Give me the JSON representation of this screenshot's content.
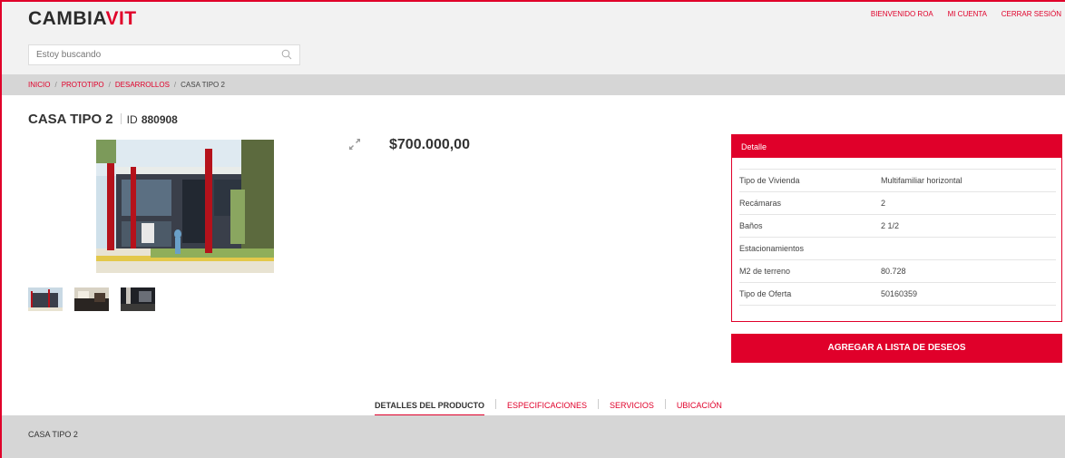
{
  "header": {
    "logo_main": "CAMBIA",
    "logo_accent": "VIT",
    "links": [
      "BIENVENIDO ROA",
      "MI CUENTA",
      "CERRAR SESIÓN"
    ]
  },
  "search": {
    "placeholder": "Estoy buscando"
  },
  "breadcrumb": {
    "items": [
      "INICIO",
      "PROTOTIPO",
      "DESARROLLOS"
    ],
    "current": "CASA TIPO 2",
    "separator": "/"
  },
  "product": {
    "title": "CASA TIPO 2",
    "id_label": "ID",
    "id_value": "880908",
    "price": "$700.000,00"
  },
  "detail": {
    "heading": "Detalle",
    "rows": [
      {
        "label": "Tipo de Vivienda",
        "value": "Multifamiliar horizontal"
      },
      {
        "label": "Recámaras",
        "value": "2"
      },
      {
        "label": "Baños",
        "value": "2 1/2"
      },
      {
        "label": "Estacionamientos",
        "value": ""
      },
      {
        "label": "M2 de terreno",
        "value": "80.728"
      },
      {
        "label": "Tipo de Oferta",
        "value": "50160359"
      }
    ]
  },
  "wishlist_button": "AGREGAR A LISTA DE DESEOS",
  "tabs": [
    {
      "label": "DETALLES DEL PRODUCTO",
      "active": true
    },
    {
      "label": "ESPECIFICACIONES",
      "active": false
    },
    {
      "label": "SERVICIOS",
      "active": false
    },
    {
      "label": "UBICACIÓN",
      "active": false
    }
  ],
  "tab_content": "CASA TIPO 2",
  "colors": {
    "accent": "#e0002a",
    "gray_bar": "#d6d6d6",
    "header_bg": "#f2f2f2"
  }
}
